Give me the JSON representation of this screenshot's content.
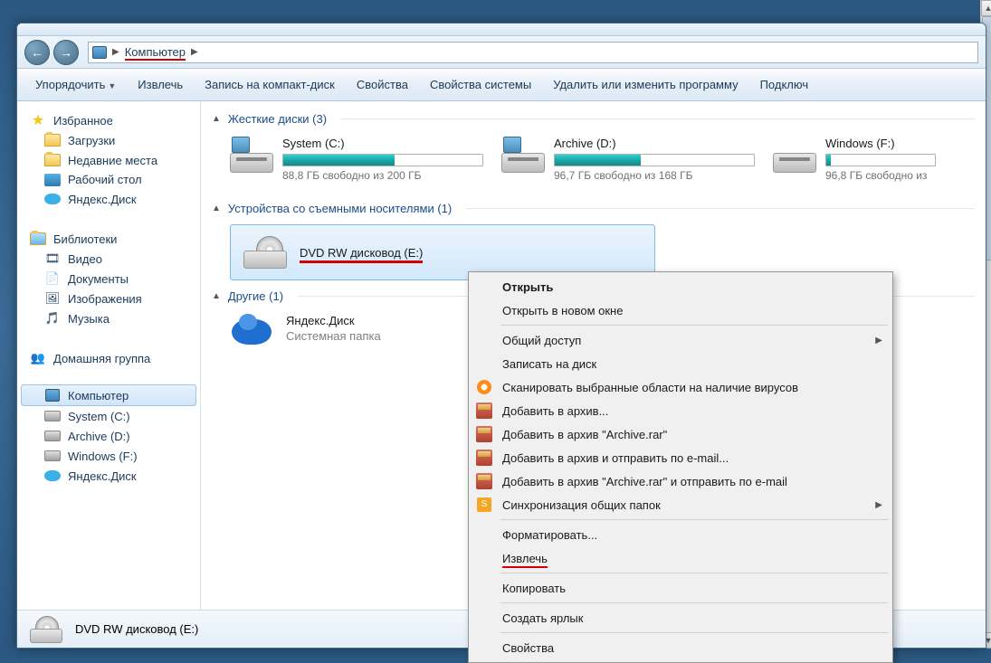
{
  "breadcrumb": {
    "computer": "Компьютер"
  },
  "toolbar": {
    "organize": "Упорядочить",
    "eject": "Извлечь",
    "burn": "Запись на компакт-диск",
    "properties": "Свойства",
    "sysprops": "Свойства системы",
    "uninstall": "Удалить или изменить программу",
    "connect": "Подключ"
  },
  "sidebar": {
    "favorites": "Избранное",
    "downloads": "Загрузки",
    "recent": "Недавние места",
    "desktop": "Рабочий стол",
    "ydisk": "Яндекс.Диск",
    "libraries": "Библиотеки",
    "video": "Видео",
    "documents": "Документы",
    "pictures": "Изображения",
    "music": "Музыка",
    "homegroup": "Домашняя группа",
    "computer": "Компьютер",
    "systemc": "System (C:)",
    "archived": "Archive (D:)",
    "windowsf": "Windows (F:)",
    "ydisk2": "Яндекс.Диск"
  },
  "groups": {
    "hdd": "Жесткие диски (3)",
    "removable": "Устройства со съемными носителями (1)",
    "other": "Другие (1)"
  },
  "drives": {
    "c": {
      "name": "System (C:)",
      "free": "88,8 ГБ свободно из 200 ГБ",
      "pct": 56
    },
    "d": {
      "name": "Archive (D:)",
      "free": "96,7 ГБ свободно из 168 ГБ",
      "pct": 43
    },
    "f": {
      "name": "Windows (F:)",
      "free": "96,8 ГБ свободно из",
      "pct": 4
    }
  },
  "dvd": {
    "name": "DVD RW дисковод (E:)"
  },
  "other": {
    "name": "Яндекс.Диск",
    "sub": "Системная папка"
  },
  "ctx": {
    "open": "Открыть",
    "opennew": "Открыть в новом окне",
    "share": "Общий доступ",
    "burn": "Записать на диск",
    "scan": "Сканировать выбранные области на наличие вирусов",
    "addarch": "Добавить в архив...",
    "addarchrar": "Добавить в архив \"Archive.rar\"",
    "addmail": "Добавить в архив и отправить по e-mail...",
    "addrarmail": "Добавить в архив \"Archive.rar\" и отправить по e-mail",
    "sync": "Синхронизация общих папок",
    "format": "Форматировать...",
    "eject": "Извлечь",
    "copy": "Копировать",
    "shortcut": "Создать ярлык",
    "props": "Свойства"
  },
  "status": {
    "dvd": "DVD RW дисковод (E:)"
  }
}
